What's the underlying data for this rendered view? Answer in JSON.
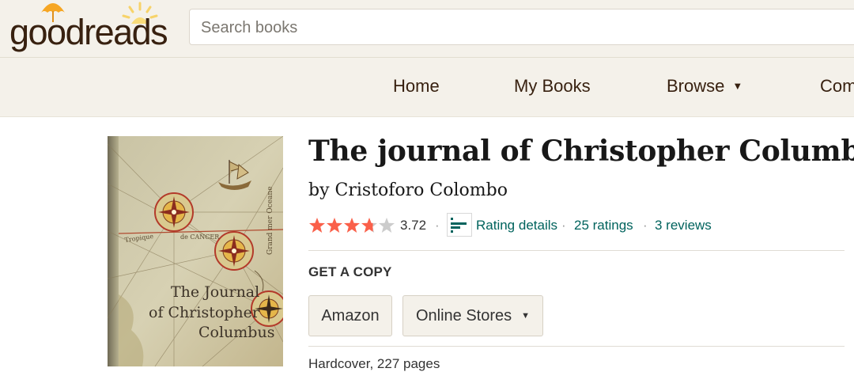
{
  "header": {
    "logo_text_light": "good",
    "logo_text_bold": "reads",
    "search_placeholder": "Search books"
  },
  "nav": {
    "items": [
      {
        "label": "Home"
      },
      {
        "label": "My Books"
      },
      {
        "label": "Browse",
        "has_dropdown": true
      },
      {
        "label": "Com"
      }
    ]
  },
  "book": {
    "title": "The journal of Christopher Columbus",
    "by_label": "by",
    "author": "Cristoforo Colombo",
    "rating": {
      "stars_value": 3.72,
      "average": "3.72",
      "separator": "·",
      "details_label": "Rating details",
      "ratings_count": "25 ratings",
      "reviews_count": "3 reviews"
    },
    "cover": {
      "title_line1": "The Journal",
      "title_line2": "of Christopher",
      "title_line3": "Columbus",
      "map_text_1": "de CANCER",
      "map_text_2": "Tropique",
      "map_text_3": "Grand mer Oceane"
    },
    "get_copy_label": "GET A COPY",
    "stores": {
      "amazon_label": "Amazon",
      "online_stores_label": "Online Stores"
    },
    "format_details": "Hardcover, 227 pages"
  },
  "colors": {
    "header_bg": "#f4f1ea",
    "brand_brown": "#382110",
    "link_teal": "#00635d",
    "star_orange": "#fa604a",
    "star_empty": "#cccccc"
  }
}
